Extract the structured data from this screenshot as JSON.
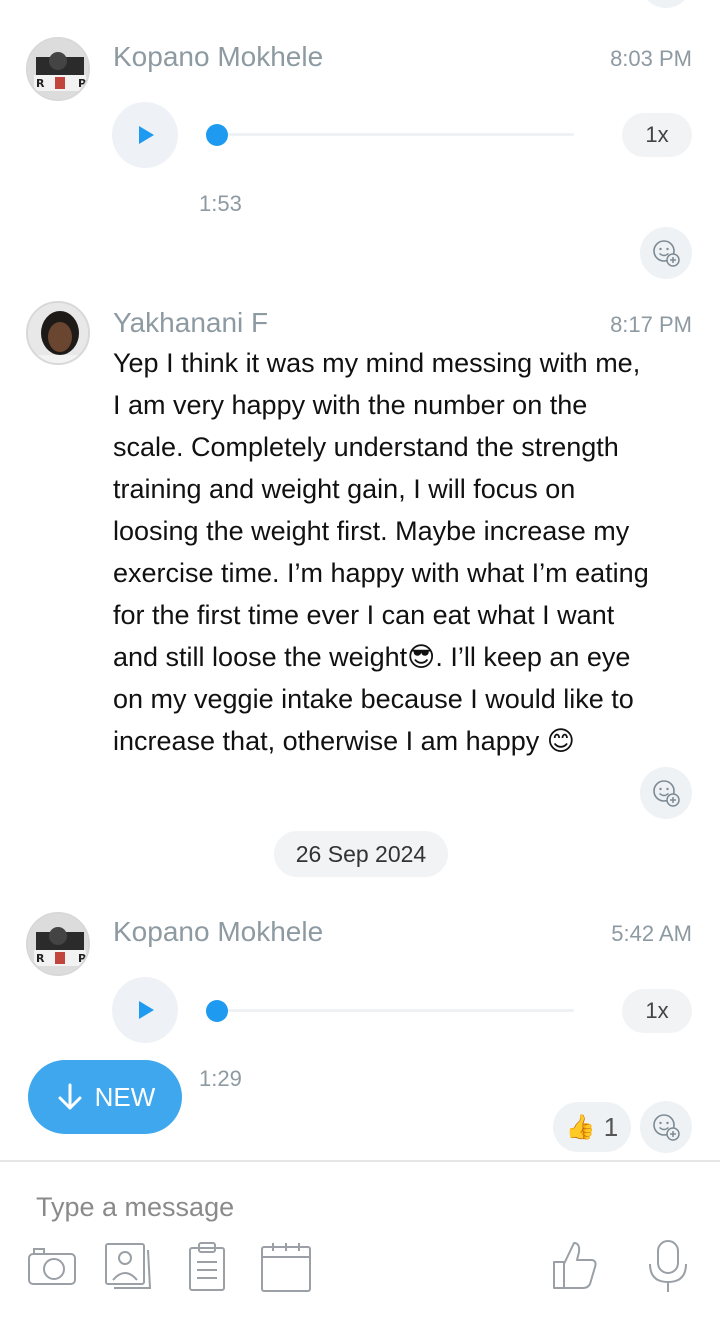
{
  "messages": [
    {
      "sender": "Kopano Mokhele",
      "time": "8:03 PM",
      "type": "voice",
      "speed": "1x",
      "duration": "1:53"
    },
    {
      "sender": "Yakhanani F",
      "time": "8:17 PM",
      "type": "text",
      "lines": [
        "Yep I think it was my mind messing with me,",
        "I am very happy with the number on the",
        "scale. Completely understand the strength",
        "training and weight gain, I will focus on",
        "loosing the weight first. Maybe increase my",
        "exercise time. I’m happy with what I’m eating",
        "for the first time ever I can eat what I want",
        "and still loose the weight😎. I’ll keep an eye",
        "on my veggie intake because I would like to",
        "increase that, otherwise I am happy 😊"
      ]
    },
    {
      "sender": "Kopano Mokhele",
      "time": "5:42 AM",
      "type": "voice",
      "speed": "1x",
      "duration": "1:29",
      "reaction_emoji": "👍",
      "reaction_count": "1"
    }
  ],
  "date_separator": "26 Sep 2024",
  "new_button": {
    "label": "NEW"
  },
  "composer": {
    "placeholder": "Type a message"
  },
  "toolbar": {
    "icons": [
      "camera-icon",
      "gallery-icon",
      "document-icon",
      "calendar-icon",
      "thumbs-up-icon",
      "microphone-icon"
    ]
  },
  "colors": {
    "accent": "#1e9bf0",
    "new_button": "#3ea7ee",
    "meta_text": "#8d9aa2"
  }
}
